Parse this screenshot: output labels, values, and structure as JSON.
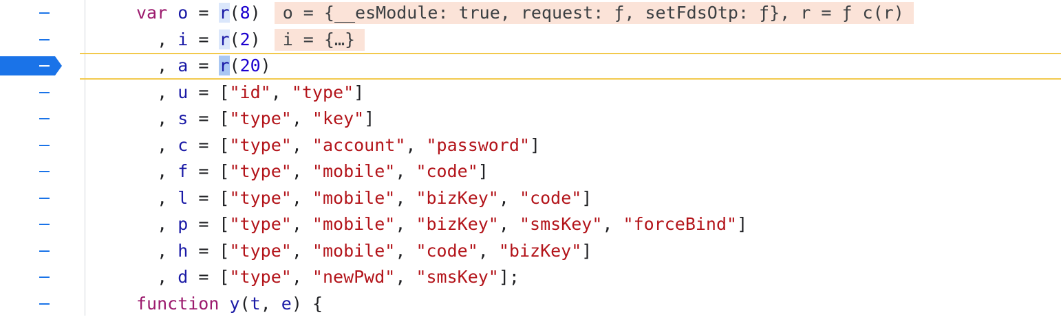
{
  "code_lines": [
    {
      "type": "var_decl",
      "keyword": "var",
      "name": "o",
      "eq": " = ",
      "call": "r",
      "arg": "8",
      "inline": "o = {__esModule: true, request: ƒ, setFdsOtp: ƒ}, r = ƒ c(r)"
    },
    {
      "type": "cont_call",
      "name": "i",
      "call": "r",
      "arg": "2",
      "inline": "i = {…}"
    },
    {
      "type": "cont_call_paused",
      "name": "a",
      "call": "r",
      "arg": "20"
    },
    {
      "type": "arr",
      "name": "u",
      "items": [
        "\"id\"",
        "\"type\""
      ],
      "end": "]"
    },
    {
      "type": "arr",
      "name": "s",
      "items": [
        "\"type\"",
        "\"key\""
      ],
      "end": "]"
    },
    {
      "type": "arr",
      "name": "c",
      "items": [
        "\"type\"",
        "\"account\"",
        "\"password\""
      ],
      "end": "]"
    },
    {
      "type": "arr",
      "name": "f",
      "items": [
        "\"type\"",
        "\"mobile\"",
        "\"code\""
      ],
      "end": "]"
    },
    {
      "type": "arr",
      "name": "l",
      "items": [
        "\"type\"",
        "\"mobile\"",
        "\"bizKey\"",
        "\"code\""
      ],
      "end": "]"
    },
    {
      "type": "arr",
      "name": "p",
      "items": [
        "\"type\"",
        "\"mobile\"",
        "\"bizKey\"",
        "\"smsKey\"",
        "\"forceBind\""
      ],
      "end": "]"
    },
    {
      "type": "arr",
      "name": "h",
      "items": [
        "\"type\"",
        "\"mobile\"",
        "\"code\"",
        "\"bizKey\""
      ],
      "end": "]"
    },
    {
      "type": "arr",
      "name": "d",
      "items": [
        "\"type\"",
        "\"newPwd\"",
        "\"smsKey\""
      ],
      "end": "];"
    },
    {
      "type": "func",
      "keyword": "function",
      "name": "y",
      "params": "t, e",
      "tail": " {"
    }
  ],
  "colors": {
    "keyword": "#9c1b6e",
    "string": "#b3141a",
    "number": "#1c00cf",
    "identifier": "#1a1aa6",
    "gutter_marker": "#1a73e8",
    "paused_line": "#f2c94c",
    "inline_value_bg": "#fbe3d8"
  }
}
